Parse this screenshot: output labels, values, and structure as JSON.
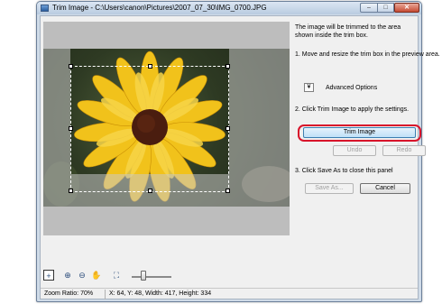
{
  "window": {
    "title": "Trim Image - C:\\Users\\canon\\Pictures\\2007_07_30\\IMG_0700.JPG",
    "minimize_glyph": "–",
    "maximize_glyph": "□",
    "close_glyph": "✕"
  },
  "panel": {
    "intro": "The image will be trimmed to the area shown inside the trim box.",
    "step1": "1.  Move and resize the trim box in the preview area.",
    "advanced_label": "Advanced Options",
    "advanced_glyph": "¥",
    "step2": "2. Click Trim Image to apply the settings.",
    "trim_button": "Trim Image",
    "undo_button": "Undo",
    "redo_button": "Redo",
    "step3": "3. Click Save As to close this panel",
    "save_as_button": "Save As...",
    "cancel_button": "Cancel"
  },
  "toolbar": {
    "fit_glyph": "+",
    "zoom_in_glyph": "⊕",
    "zoom_out_glyph": "⊖",
    "hand_glyph": "✋",
    "fullscreen_glyph": "⛶",
    "zoom_slider_level": 0.25
  },
  "status": {
    "zoom_ratio": "Zoom Ratio: 70%",
    "selection": "X: 64, Y: 48, Width: 417, Height: 334"
  },
  "colors": {
    "highlight": "#d8122a",
    "petal": "#f1c21b",
    "center": "#4a1d0f"
  }
}
